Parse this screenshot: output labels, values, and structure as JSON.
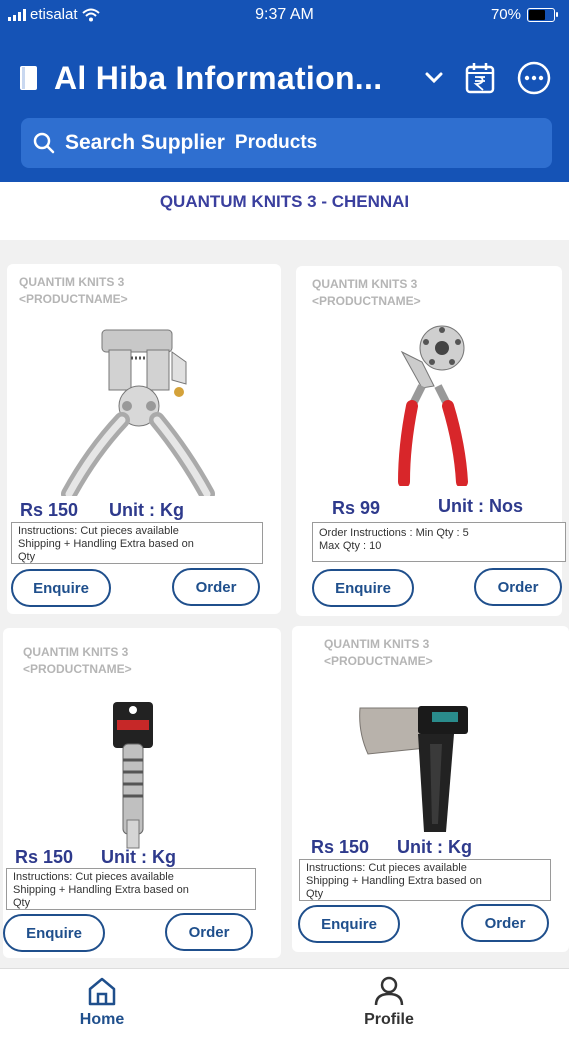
{
  "status": {
    "carrier": "etisalat",
    "time": "9:37 AM",
    "battery": "70%",
    "battery_level": 0.7
  },
  "header": {
    "title": "Al Hiba Information...",
    "book_icon": "book-icon",
    "chevron_icon": "chevron-down-icon",
    "calendar_icon": "calendar-rupee-icon",
    "more_icon": "more-options-icon"
  },
  "search": {
    "label": "Search Supplier",
    "scope": "Products",
    "icon": "search-icon"
  },
  "supplier": {
    "name": "QUANTUM KNITS 3 - CHENNAI"
  },
  "products": [
    {
      "supplier": "QUANTIM KNITS 3",
      "name": "<PRODUCTNAME>",
      "price": "Rs 150",
      "unit": "Unit : Kg",
      "instructions": [
        "Instructions:  Cut pieces available",
        "Shipping + Handling Extra based on",
        "Qty"
      ],
      "enquire": "Enquire",
      "order": "Order",
      "image": "plier-icon"
    },
    {
      "supplier": "QUANTIM KNITS 3",
      "name": "<PRODUCTNAME>",
      "price": "Rs 99",
      "unit": "Unit : Nos",
      "instructions": [
        "Order Instructions : Min Qty : 5",
        "Max Qty : 10"
      ],
      "enquire": "Enquire",
      "order": "Order",
      "image": "hole-punch-icon"
    },
    {
      "supplier": "QUANTIM KNITS 3",
      "name": "<PRODUCTNAME>",
      "price": "Rs 150",
      "unit": "Unit : Kg",
      "instructions": [
        "Instructions:  Cut pieces available",
        "Shipping + Handling Extra based on",
        "Qty"
      ],
      "enquire": "Enquire",
      "order": "Order",
      "image": "wrench-tool-icon"
    },
    {
      "supplier": "QUANTIM KNITS 3",
      "name": "<PRODUCTNAME>",
      "price": "Rs 150",
      "unit": "Unit : Kg",
      "instructions": [
        "Instructions:  Cut pieces available",
        "Shipping + Handling Extra based on",
        "Qty"
      ],
      "enquire": "Enquire",
      "order": "Order",
      "image": "axe-icon"
    }
  ],
  "tabs": [
    {
      "label": "Home",
      "icon": "home-icon",
      "color": "#1f4f8c"
    },
    {
      "label": "Profile",
      "icon": "user-icon",
      "color": "#333333"
    }
  ],
  "colors": {
    "header": "#1553b6",
    "accent": "#2e3a8c",
    "button": "#1f4f8c"
  }
}
